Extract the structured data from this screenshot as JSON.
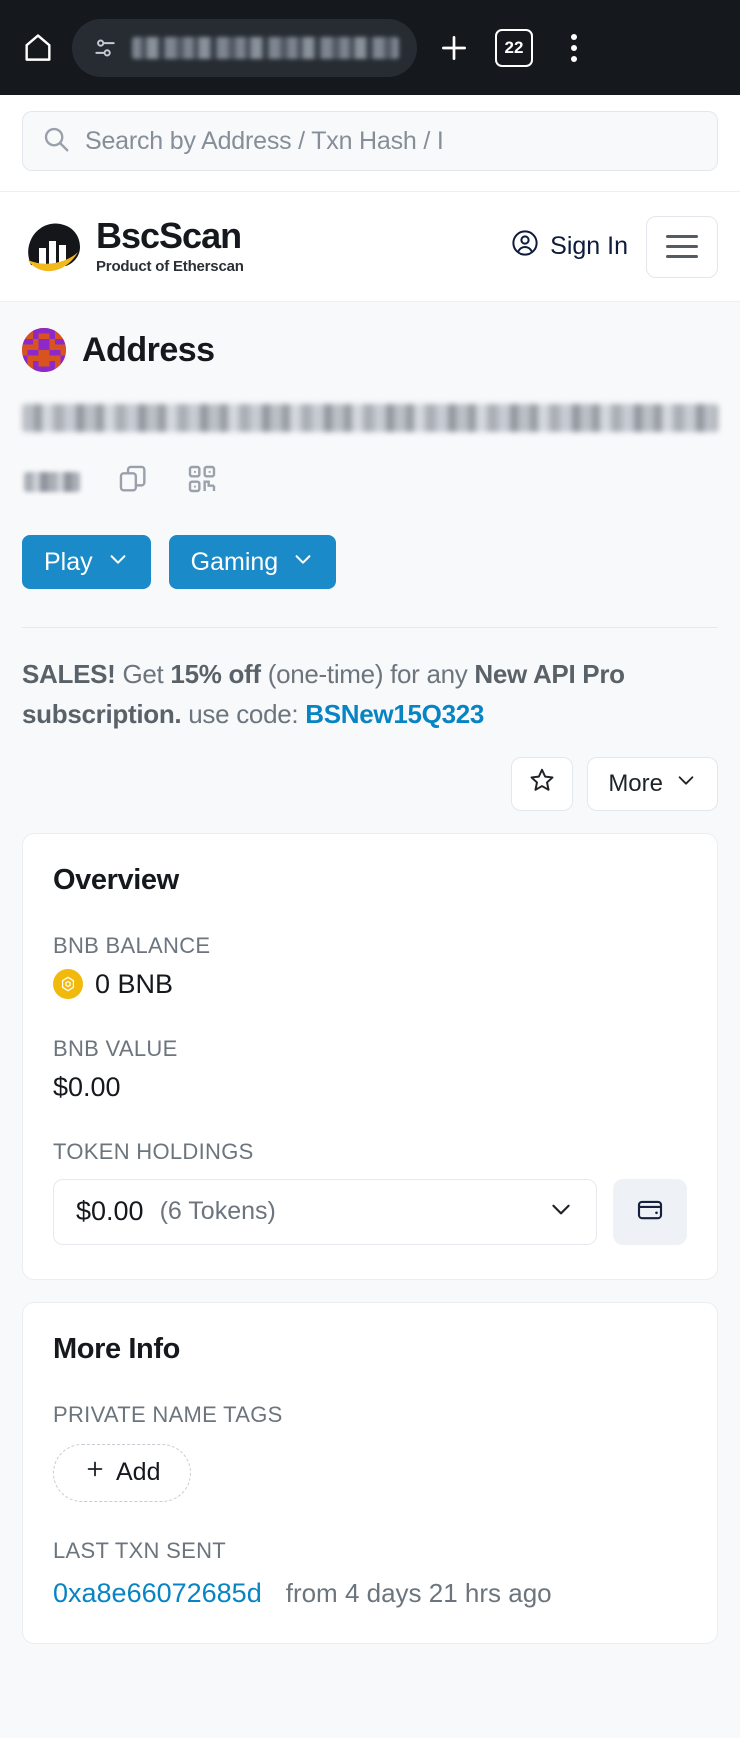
{
  "browser": {
    "home_icon": "home-icon",
    "url_tune_icon": "page-info-icon",
    "url_value": "",
    "new_tab_label": "+",
    "tab_count": "22",
    "menu_icon": "overflow-menu-icon"
  },
  "search": {
    "placeholder": "Search by Address / Txn Hash / I",
    "icon": "search-icon"
  },
  "header": {
    "brand": "BscScan",
    "brand_sub_prefix": "Product of ",
    "brand_sub_strong": "Etherscan",
    "sign_in": "Sign In",
    "sign_in_icon": "account-circle-icon",
    "menu_icon": "hamburger-menu-icon"
  },
  "address": {
    "title": "Address",
    "avatar": "address-blockie-avatar",
    "hash": "",
    "short_label": "",
    "copy_icon": "copy-icon",
    "qr_icon": "qr-code-icon",
    "tags": [
      {
        "label": "Play",
        "icon": "chevron-down-icon"
      },
      {
        "label": "Gaming",
        "icon": "chevron-down-icon"
      }
    ]
  },
  "sales": {
    "lead": "SALES!",
    "text1": " Get ",
    "discount": "15% off",
    "text2": " (one-time) for any ",
    "product": "New API Pro subscription.",
    "text3": " use code: ",
    "code": "BSNew15Q323"
  },
  "actions": {
    "star_icon": "star-outline-icon",
    "more_label": "More",
    "more_icon": "chevron-down-icon"
  },
  "overview": {
    "title": "Overview",
    "bnb_balance_label": "BNB BALANCE",
    "bnb_balance_value": "0 BNB",
    "bnb_coin_icon": "bnb-coin-icon",
    "bnb_value_label": "BNB VALUE",
    "bnb_value_value": "$0.00",
    "token_holdings_label": "TOKEN HOLDINGS",
    "token_amount": "$0.00",
    "token_count": "(6 Tokens)",
    "token_chevron_icon": "chevron-down-icon",
    "wallet_icon": "wallet-icon"
  },
  "more_info": {
    "title": "More Info",
    "private_name_tags_label": "PRIVATE NAME TAGS",
    "add_label": "Add",
    "add_icon": "plus-icon",
    "last_txn_label": "LAST TXN SENT",
    "last_txn_hash": "0xa8e66072685d",
    "last_txn_ago": "from 4 days 21 hrs ago"
  },
  "colors": {
    "accent_blue": "#1a8ac9",
    "link_blue": "#0784c3",
    "bnb_yellow": "#f0b90b",
    "chrome_dark": "#15191e"
  }
}
